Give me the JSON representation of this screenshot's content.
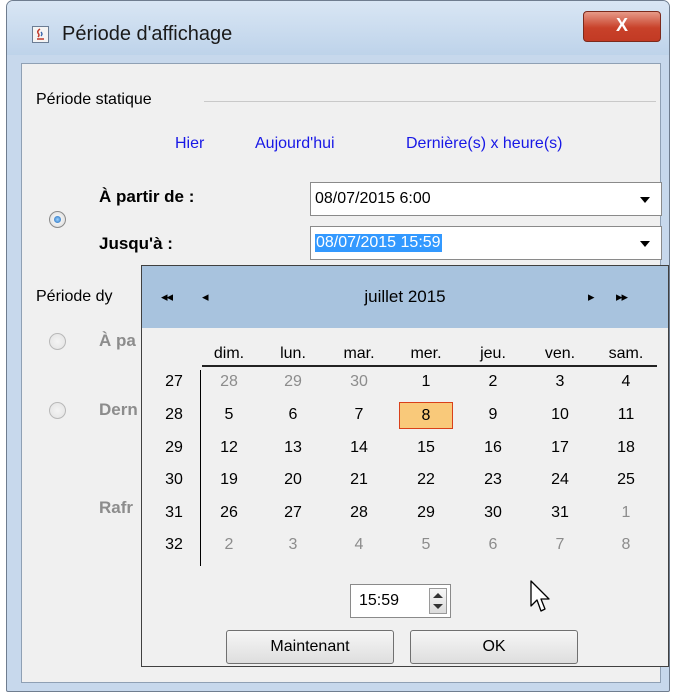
{
  "window": {
    "title": "Période d'affichage",
    "close_label": "X"
  },
  "static_section": {
    "label": "Période statique",
    "links": [
      "Hier",
      "Aujourd'hui",
      "Dernière(s) x heure(s)"
    ],
    "from_label": "À partir de :",
    "from_value": "08/07/2015 6:00",
    "to_label": "Jusqu'à :",
    "to_value": "08/07/2015 15:59"
  },
  "dynamic_section": {
    "label": "Période dy",
    "option1_label": "À pa",
    "option2_label": "Dern",
    "refresh_label": "Rafr"
  },
  "calendar": {
    "nav_first": "◂◂",
    "nav_prev": "◂",
    "nav_next": "▸",
    "nav_last": "▸▸",
    "month_title": "juillet  2015",
    "weekdays": [
      "dim.",
      "lun.",
      "mar.",
      "mer.",
      "jeu.",
      "ven.",
      "sam."
    ],
    "weeks": [
      "27",
      "28",
      "29",
      "30",
      "31",
      "32"
    ],
    "days": [
      [
        "28",
        "29",
        "30",
        "1",
        "2",
        "3",
        "4"
      ],
      [
        "5",
        "6",
        "7",
        "8",
        "9",
        "10",
        "11"
      ],
      [
        "12",
        "13",
        "14",
        "15",
        "16",
        "17",
        "18"
      ],
      [
        "19",
        "20",
        "21",
        "22",
        "23",
        "24",
        "25"
      ],
      [
        "26",
        "27",
        "28",
        "29",
        "30",
        "31",
        "1"
      ],
      [
        "2",
        "3",
        "4",
        "5",
        "6",
        "7",
        "8"
      ]
    ],
    "selected_day": "8",
    "time_value": "15:59",
    "now_button": "Maintenant",
    "ok_button": "OK"
  },
  "colors": {
    "link": "#1818e6",
    "header": "#a8c3de",
    "today_bg": "#f9c97a",
    "today_border": "#d9401a",
    "selection": "#3399ff"
  }
}
